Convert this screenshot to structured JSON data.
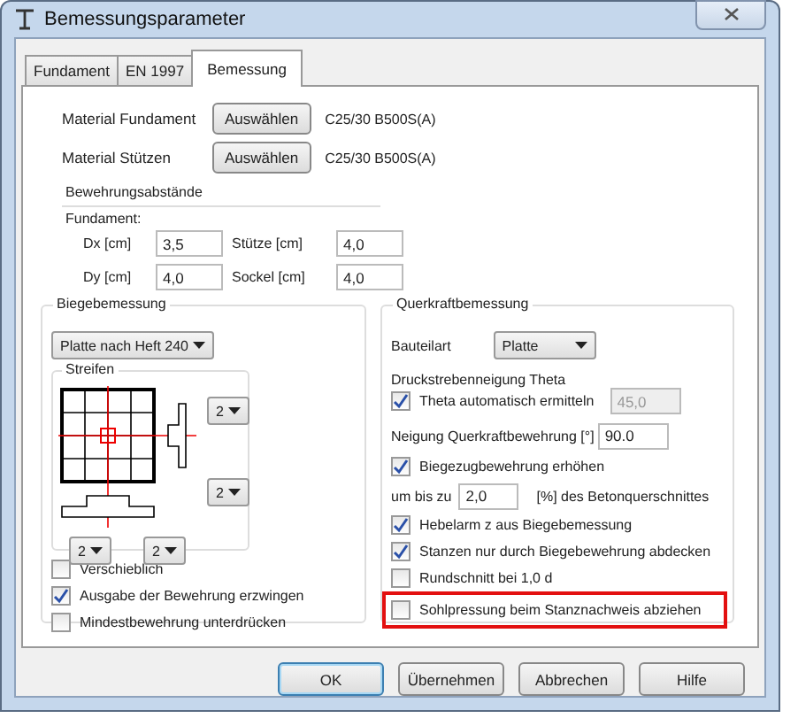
{
  "window": {
    "title": "Bemessungsparameter"
  },
  "tabs": [
    {
      "label": "Fundament",
      "selected": false
    },
    {
      "label": "EN 1997",
      "selected": false
    },
    {
      "label": "Bemessung",
      "selected": true
    }
  ],
  "materials": [
    {
      "label": "Material Fundament",
      "button": "Auswählen",
      "value": "C25/30 B500S(A)"
    },
    {
      "label": "Material Stützen",
      "button": "Auswählen",
      "value": "C25/30 B500S(A)"
    }
  ],
  "reinforcement_spacing": {
    "title": "Bewehrungsabstände",
    "subtitle": "Fundament:",
    "fields": [
      {
        "label": "Dx [cm]",
        "value": "3,5"
      },
      {
        "label": "Stütze [cm]",
        "value": "4,0"
      },
      {
        "label": "Dy [cm]",
        "value": "4,0"
      },
      {
        "label": "Sockel [cm]",
        "value": "4,0"
      }
    ]
  },
  "bending": {
    "title": "Biegebemessung",
    "method": "Platte nach Heft 240",
    "strips": {
      "title": "Streifen",
      "right_dropdowns": [
        "2",
        "2"
      ],
      "bottom_dropdowns": [
        "2",
        "2"
      ]
    },
    "options": [
      {
        "label": "Verschieblich",
        "checked": false
      },
      {
        "label": "Ausgabe der Bewehrung erzwingen",
        "checked": true
      },
      {
        "label": "Mindestbewehrung unterdrücken",
        "checked": false
      }
    ]
  },
  "shear": {
    "title": "Querkraftbemessung",
    "component_label": "Bauteilart",
    "component": "Platte",
    "theta_heading": "Druckstrebenneigung Theta",
    "theta_auto": {
      "label": "Theta automatisch ermitteln",
      "checked": true,
      "value": "45,0",
      "disabled": true
    },
    "inclination": {
      "label": "Neigung Querkraftbewehrung [°]",
      "value": "90.0"
    },
    "increase": {
      "label": "Biegezugbewehrung erhöhen",
      "checked": true
    },
    "increase_limit": {
      "prefix": "um bis zu",
      "value": "2,0",
      "suffix": "[%] des Betonquerschnittes"
    },
    "options": [
      {
        "label": "Hebelarm z aus Biegebemessung",
        "checked": true,
        "highlighted": false
      },
      {
        "label": "Stanzen nur durch Biegebewehrung abdecken",
        "checked": true,
        "highlighted": false
      },
      {
        "label": "Rundschnitt bei 1,0 d",
        "checked": false,
        "highlighted": false
      },
      {
        "label": "Sohlpressung beim Stanznachweis abziehen",
        "checked": false,
        "highlighted": true
      }
    ]
  },
  "buttons": [
    {
      "label": "OK",
      "default": true
    },
    {
      "label": "Übernehmen",
      "default": false
    },
    {
      "label": "Abbrechen",
      "default": false
    },
    {
      "label": "Hilfe",
      "default": false
    }
  ]
}
